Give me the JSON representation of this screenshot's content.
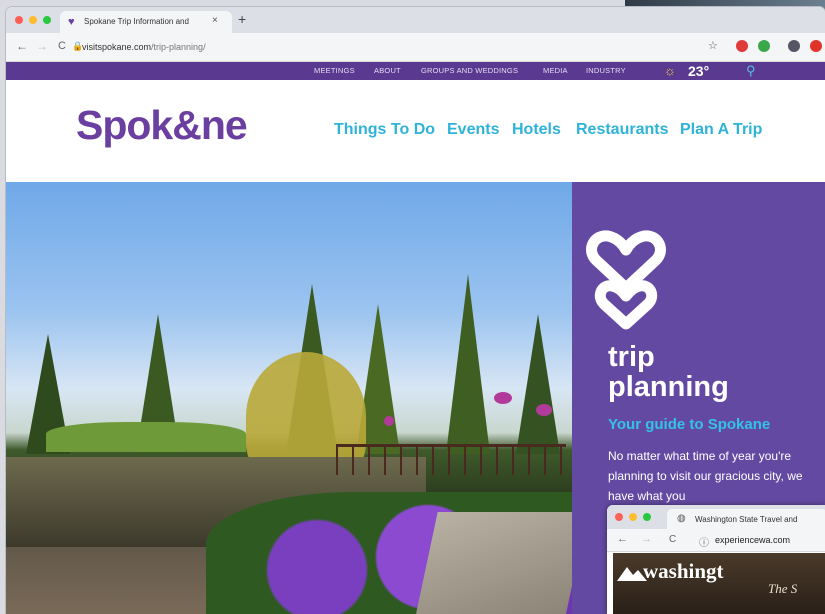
{
  "browser": {
    "tab_title": "Spokane Trip Information and",
    "tab_close": "×",
    "new_tab": "+",
    "url_host": "visitspokane.com",
    "url_path": "/trip-planning/",
    "buttons": {
      "back": "←",
      "forward": "→",
      "reload": "C",
      "lock": "🔒",
      "star": "☆"
    }
  },
  "topbar": {
    "links": [
      "MEETINGS",
      "ABOUT",
      "GROUPS AND WEDDINGS",
      "MEDIA",
      "INDUSTRY"
    ],
    "temperature": "23°",
    "weather_icon": "sun-icon"
  },
  "site": {
    "logo": "Spok&ne",
    "nav": [
      "Things To Do",
      "Events",
      "Hotels",
      "Restaurants",
      "Plan A Trip"
    ]
  },
  "panel": {
    "heading_line1": "trip",
    "heading_line2": "planning",
    "subheading": "Your guide to Spokane",
    "body": "No matter what time of year you're planning to visit our gracious city, we have what you"
  },
  "popup": {
    "tab_title": "Washington State Travel and",
    "url": "experiencewa.com",
    "brand": "washingt",
    "tagline": "The S"
  },
  "colors": {
    "purple": "#6449a2",
    "top_purple": "#5a3990",
    "cyan": "#2fb3d8"
  }
}
